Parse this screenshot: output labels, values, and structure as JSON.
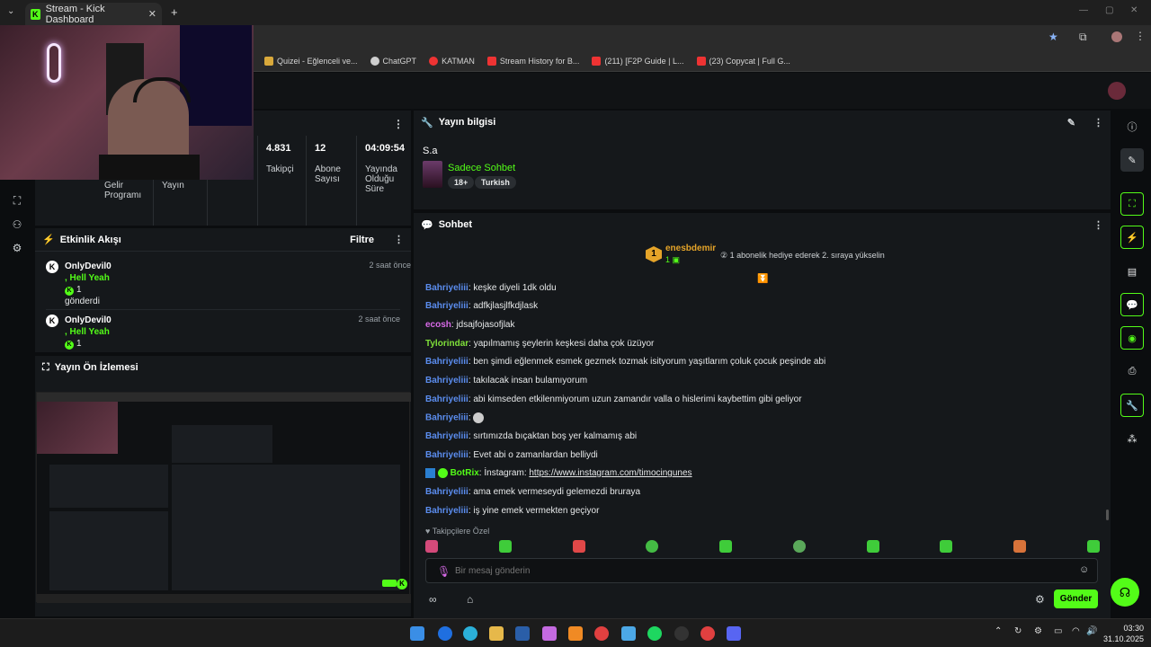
{
  "browser": {
    "tab_title": "Stream - Kick Dashboard",
    "new_tab": "+",
    "bookmarks": [
      {
        "label": "Quizei - Eğlenceli ve...",
        "color": "#d9a93b"
      },
      {
        "label": "ChatGPT",
        "color": "#cfcfcf"
      },
      {
        "label": "KATMAN",
        "color": "#e33"
      },
      {
        "label": "Stream History for B...",
        "color": "#e33"
      },
      {
        "label": "(211) [F2P Guide | L...",
        "color": "#e33"
      },
      {
        "label": "(23) Copycat | Full G...",
        "color": "#e33"
      }
    ]
  },
  "stats": {
    "followers_value": "4.831",
    "followers_label": "Takipçi",
    "subs_value": "12",
    "subs_label": "Abone Sayısı",
    "live_value": "04:09:54",
    "live_label": "Yayında Olduğu Süre",
    "income_label": "Gelir Programı",
    "stream_label": "Yayın"
  },
  "activity": {
    "title": "Etkinlik Akışı",
    "filter": "Filtre",
    "items": [
      {
        "user": "OnlyDevil0",
        "message": ", Hell Yeah",
        "count": "1",
        "extra": "gönderdi",
        "time": "2 saat önce"
      },
      {
        "user": "OnlyDevil0",
        "message": ", Hell Yeah",
        "count": "1",
        "extra": "",
        "time": "2 saat önce"
      }
    ]
  },
  "preview": {
    "title": "Yayın Ön İzlemesi"
  },
  "stream_info": {
    "title": "Yayın bilgisi",
    "stream_title": "S.a",
    "category": "Sadece Sohbet",
    "tag1": "18+",
    "tag2": "Turkish"
  },
  "chat": {
    "title": "Sohbet",
    "gifter_rank": "1",
    "gifter_name": "enesbdemir",
    "gifter_count": "1",
    "gift_prompt": "1 abonelik hediye ederek 2. sıraya yükselin",
    "messages": [
      {
        "user": "Bahriyeliii",
        "color": "#5b8def",
        "text": ": keşke diyeli 1dk oldu"
      },
      {
        "user": "Bahriyeliii",
        "color": "#5b8def",
        "text": ": adfkjlasjlfkdjlask"
      },
      {
        "user": "ecosh",
        "color": "#d86ae8",
        "text": ": jdsajfojasofjlak"
      },
      {
        "user": "Tylorindar",
        "color": "#7fe03a",
        "text": ": yapılmamış şeylerin keşkesi daha çok üzüyor"
      },
      {
        "user": "Bahriyeliii",
        "color": "#5b8def",
        "text": ": ben şimdi eğlenmek esmek gezmek tozmak isityorum yaşıtlarım çoluk çocuk peşinde abi"
      },
      {
        "user": "Bahriyeliii",
        "color": "#5b8def",
        "text": ": takılacak insan bulamıyorum"
      },
      {
        "user": "Bahriyeliii",
        "color": "#5b8def",
        "text": ": abi kimseden etkilenmiyorum uzun zamandır valla o hislerimi kaybettim gibi geliyor"
      },
      {
        "user": "Bahriyeliii",
        "color": "#5b8def",
        "text": ":"
      },
      {
        "user": "Bahriyeliii",
        "color": "#5b8def",
        "text": ": sırtımızda bıçaktan boş yer kalmamış abi"
      },
      {
        "user": "Bahriyeliii",
        "color": "#5b8def",
        "text": ": Evet abi o zamanlardan belliydi"
      },
      {
        "user": "BotRix",
        "color": "#53fc18",
        "text": ": İnstagram: ",
        "link": "https://www.instagram.com/timocingunes"
      },
      {
        "user": "Bahriyeliii",
        "color": "#5b8def",
        "text": ": ama emek vermeseydi gelemezdi bruraya"
      },
      {
        "user": "Bahriyeliii",
        "color": "#5b8def",
        "text": ": iş yine emek vermekten geçiyor"
      }
    ],
    "followers_only": "Takipçilere Özel",
    "input_placeholder": "Bir mesaj gönderin",
    "send": "Gönder"
  },
  "taskbar": {
    "time": "03:30",
    "date": "31.10.2025"
  },
  "colors": {
    "accent": "#53fc18",
    "panel": "#15181b",
    "bg": "#0b0d0f"
  }
}
